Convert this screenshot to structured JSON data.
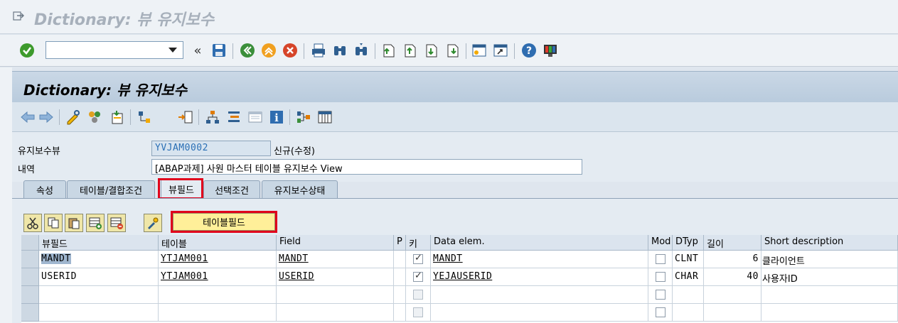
{
  "window": {
    "title": "Dictionary: 뷰 유지보수"
  },
  "screen": {
    "title": "Dictionary: 뷰 유지보수"
  },
  "header": {
    "view_label": "유지보수뷰",
    "view_value": "YVJAM0002",
    "view_status": "신규(수정)",
    "desc_label": "내역",
    "desc_value": "[ABAP과제] 사원 마스터 테이블 유지보수 View"
  },
  "tabs": [
    {
      "label": "속성"
    },
    {
      "label": "테이블/결합조건"
    },
    {
      "label": "뷰필드"
    },
    {
      "label": "선택조건"
    },
    {
      "label": "유지보수상태"
    }
  ],
  "table_fields_button": "테이블필드",
  "grid": {
    "columns": [
      "뷰필드",
      "테이블",
      "Field",
      "P",
      "키",
      "Data elem.",
      "Mod",
      "DTyp",
      "길이",
      "Short description"
    ],
    "rows": [
      {
        "view_field": "MANDT",
        "table": "YTJAM001",
        "field": "MANDT",
        "p": "",
        "key": true,
        "data_elem": "MANDT",
        "mod": false,
        "dtyp": "CLNT",
        "length": "6",
        "desc": "클라이언트"
      },
      {
        "view_field": "USERID",
        "table": "YTJAM001",
        "field": "USERID",
        "p": "",
        "key": true,
        "data_elem": "YEJAUSERID",
        "mod": false,
        "dtyp": "CHAR",
        "length": "40",
        "desc": "사용자ID"
      }
    ]
  },
  "colors": {
    "accent_red": "#e0001b",
    "title_band": "#b9cbdd"
  }
}
